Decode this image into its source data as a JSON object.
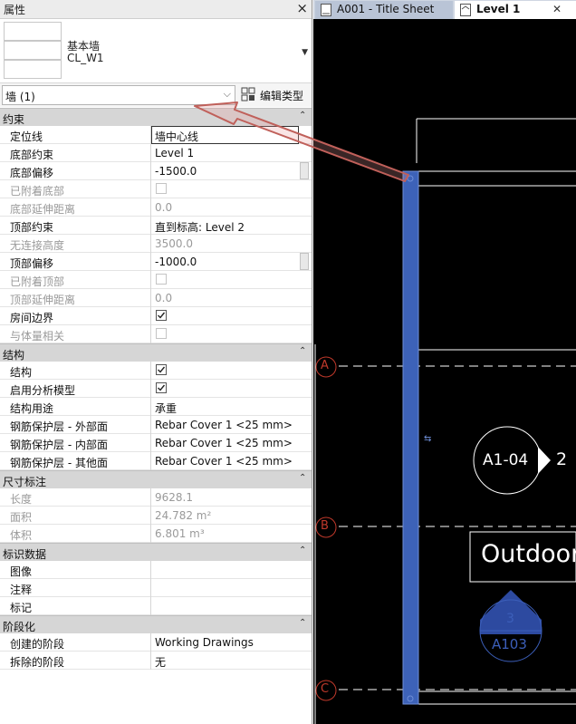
{
  "panel": {
    "title": "属性"
  },
  "type_selector": {
    "family": "基本墙",
    "type": "CL_W1"
  },
  "filter": {
    "value": "墙 (1)",
    "edit_type_label": "编辑类型"
  },
  "sections": [
    {
      "label": "约束",
      "rows": [
        {
          "name": "定位线",
          "value": "墙中心线",
          "state": "edit"
        },
        {
          "name": "底部约束",
          "value": "Level 1"
        },
        {
          "name": "底部偏移",
          "value": "-1500.0",
          "state": "scroll"
        },
        {
          "name": "已附着底部",
          "value": "",
          "state": "cb-off"
        },
        {
          "name": "底部延伸距离",
          "value": "0.0",
          "state": "dis"
        },
        {
          "name": "顶部约束",
          "value": "直到标高: Level 2"
        },
        {
          "name": "无连接高度",
          "value": "3500.0",
          "state": "dis"
        },
        {
          "name": "顶部偏移",
          "value": "-1000.0",
          "state": "scroll"
        },
        {
          "name": "已附着顶部",
          "value": "",
          "state": "cb-off"
        },
        {
          "name": "顶部延伸距离",
          "value": "0.0",
          "state": "dis"
        },
        {
          "name": "房间边界",
          "value": "",
          "state": "cb-on"
        },
        {
          "name": "与体量相关",
          "value": "",
          "state": "cb-off"
        }
      ]
    },
    {
      "label": "结构",
      "rows": [
        {
          "name": "结构",
          "value": "",
          "state": "cb-on"
        },
        {
          "name": "启用分析模型",
          "value": "",
          "state": "cb-on"
        },
        {
          "name": "结构用途",
          "value": "承重"
        },
        {
          "name": "钢筋保护层 - 外部面",
          "value": "Rebar Cover 1 <25 mm>"
        },
        {
          "name": "钢筋保护层 - 内部面",
          "value": "Rebar Cover 1 <25 mm>"
        },
        {
          "name": "钢筋保护层 - 其他面",
          "value": "Rebar Cover 1 <25 mm>"
        }
      ]
    },
    {
      "label": "尺寸标注",
      "rows": [
        {
          "name": "长度",
          "value": "9628.1",
          "state": "dis"
        },
        {
          "name": "面积",
          "value": "24.782 m²",
          "state": "dis"
        },
        {
          "name": "体积",
          "value": "6.801 m³",
          "state": "dis"
        }
      ]
    },
    {
      "label": "标识数据",
      "rows": [
        {
          "name": "图像",
          "value": ""
        },
        {
          "name": "注释",
          "value": ""
        },
        {
          "name": "标记",
          "value": ""
        }
      ]
    },
    {
      "label": "阶段化",
      "rows": [
        {
          "name": "创建的阶段",
          "value": "Working Drawings"
        },
        {
          "name": "拆除的阶段",
          "value": "无"
        }
      ]
    }
  ],
  "tabs": [
    {
      "label": "A001 - Title Sheet",
      "active": false
    },
    {
      "label": "Level 1",
      "active": true
    }
  ],
  "drawing": {
    "grid_labels": [
      "A",
      "B",
      "C"
    ],
    "section_tag": {
      "number": "2",
      "sheet": "A1-04"
    },
    "elevation_tag": {
      "number": "3",
      "sheet": "A103"
    },
    "room_label": "Outdoor",
    "colors": {
      "wall": "#3d62b8",
      "grid": "#c0392b",
      "arrow": "#c0605a"
    }
  }
}
